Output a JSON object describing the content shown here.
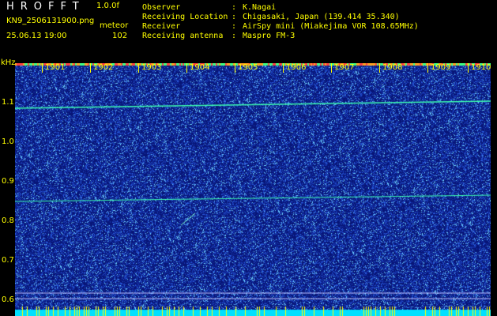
{
  "header": {
    "app_title": "HROFFT",
    "version": "1.0.0f",
    "filename": "KN9_2506131900.png",
    "mode": "meteor",
    "timestamp": "25.06.13 19:00",
    "count": "102"
  },
  "info": [
    {
      "label": "Observer",
      "colon": ":",
      "value": "K.Nagai"
    },
    {
      "label": "Receiving Location",
      "colon": ":",
      "value": "Chigasaki, Japan (139.414 35.340)"
    },
    {
      "label": "Receiver",
      "colon": ":",
      "value": "AirSpy mini (Miakejima VOR 108.65MHz)"
    },
    {
      "label": "Receiving antenna",
      "colon": ":",
      "value": "Maspro FM-3"
    }
  ],
  "y_axis": {
    "unit": "kHz",
    "ticks": [
      "1.1",
      "1.0",
      "0.9",
      "0.8",
      "0.7",
      "0.6"
    ]
  },
  "x_axis": {
    "ticks": [
      "1901",
      "1902",
      "1903",
      "1904",
      "1905",
      "1906",
      "1907",
      "1908",
      "1909",
      "1910"
    ]
  },
  "colors": {
    "background": "#0a1a8c",
    "noise": "#5ad0ff",
    "label": "#ffff00",
    "carrier": "#3cffb0"
  }
}
